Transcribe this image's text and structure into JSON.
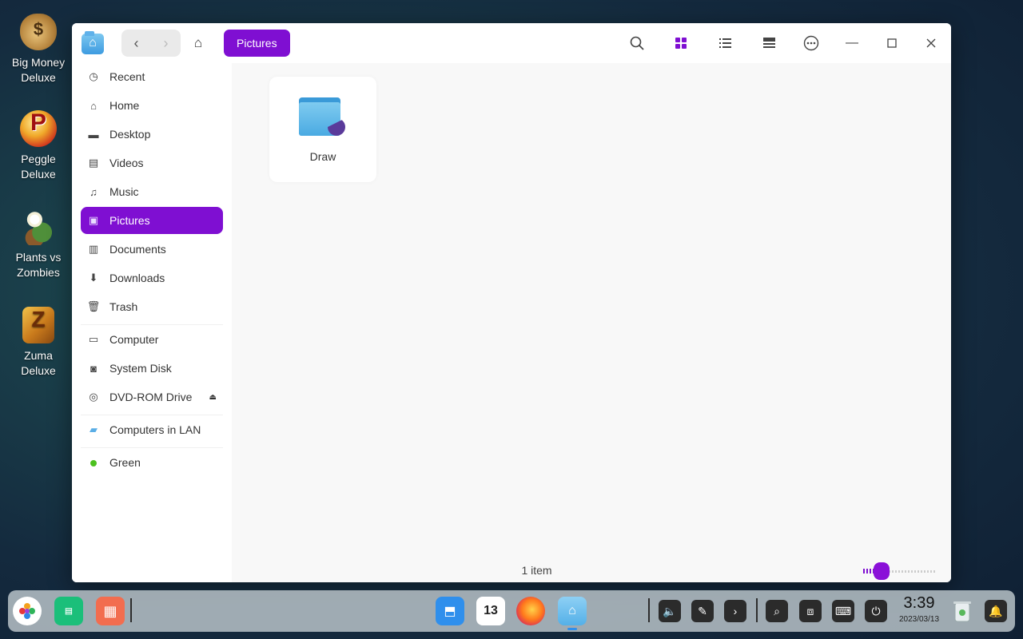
{
  "desktop": {
    "icons": [
      {
        "label": "Big Money Deluxe"
      },
      {
        "label": "Peggle Deluxe"
      },
      {
        "label": "Plants vs Zombies"
      },
      {
        "label": "Zuma Deluxe"
      }
    ]
  },
  "window": {
    "accent": "#7f0fd2",
    "breadcrumb": "Pictures",
    "sidebar": {
      "items": [
        {
          "label": "Recent",
          "icon": "clock-icon"
        },
        {
          "label": "Home",
          "icon": "home-icon"
        },
        {
          "label": "Desktop",
          "icon": "desktop-icon"
        },
        {
          "label": "Videos",
          "icon": "film-icon"
        },
        {
          "label": "Music",
          "icon": "music-note-icon"
        },
        {
          "label": "Pictures",
          "icon": "picture-icon",
          "active": true
        },
        {
          "label": "Documents",
          "icon": "document-icon"
        },
        {
          "label": "Downloads",
          "icon": "download-icon"
        },
        {
          "label": "Trash",
          "icon": "trash-icon"
        },
        {
          "label": "Computer",
          "icon": "computer-icon"
        },
        {
          "label": "System Disk",
          "icon": "disk-icon"
        },
        {
          "label": "DVD-ROM Drive",
          "icon": "dvd-icon"
        },
        {
          "label": "Computers in LAN",
          "icon": "network-folder-icon"
        },
        {
          "label": "Green",
          "icon": "green-tag-icon"
        }
      ]
    },
    "files": [
      {
        "name": "Draw",
        "type": "folder"
      }
    ],
    "status": "1 item",
    "icon_size_level": 0.2
  },
  "taskbar": {
    "clock_time": "3:39",
    "clock_date": "2023/03/13",
    "calendar_day": "13"
  }
}
